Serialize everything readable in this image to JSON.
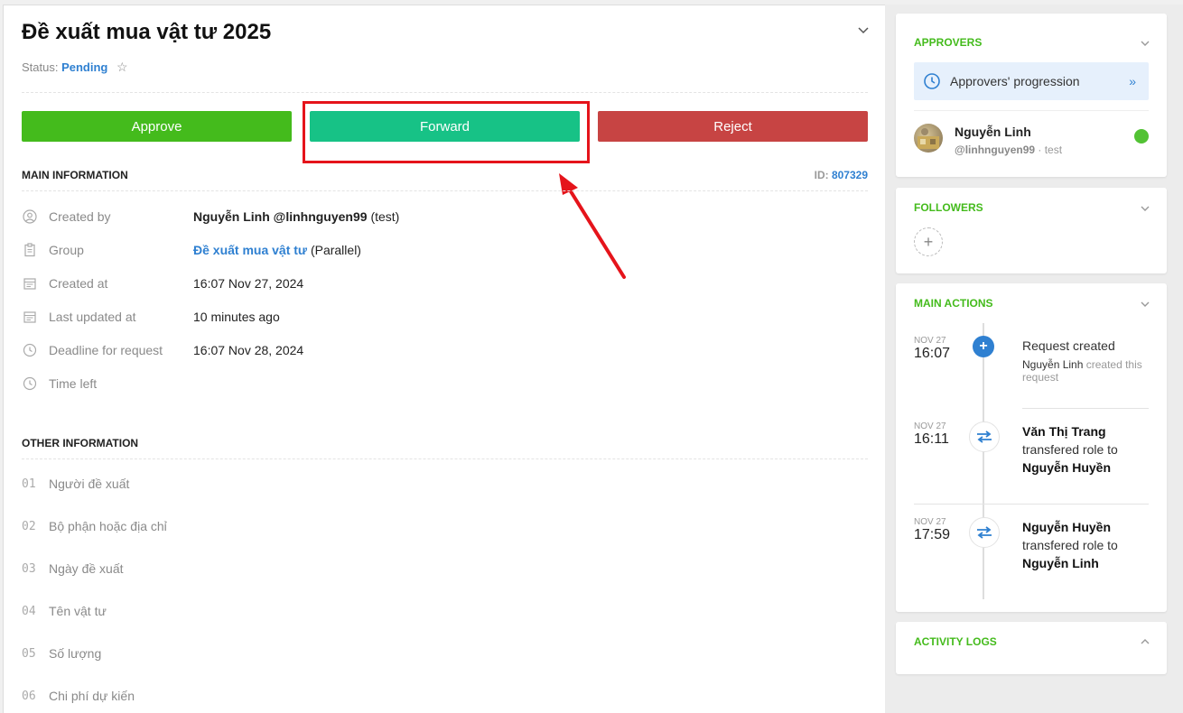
{
  "request": {
    "title": "Đề xuất mua vật tư 2025",
    "status_label": "Status:",
    "status_value": "Pending"
  },
  "actions": {
    "approve": "Approve",
    "forward": "Forward",
    "reject": "Reject"
  },
  "main_info": {
    "heading": "MAIN INFORMATION",
    "id_label": "ID:",
    "id_value": "807329",
    "rows": [
      {
        "label": "Created by",
        "value_bold": "Nguyễn Linh @linhnguyen99",
        "value_rest": " (test)"
      },
      {
        "label": "Group",
        "value_link": "Đề xuất mua vật tư",
        "value_rest": " (Parallel)"
      },
      {
        "label": "Created at",
        "value": "16:07 Nov 27, 2024"
      },
      {
        "label": "Last updated at",
        "value": "10 minutes ago"
      },
      {
        "label": "Deadline for request",
        "value": "16:07 Nov 28, 2024"
      },
      {
        "label": "Time left",
        "value": ""
      }
    ]
  },
  "other_info": {
    "heading": "OTHER INFORMATION",
    "rows": [
      {
        "num": "01",
        "label": "Người đề xuất"
      },
      {
        "num": "02",
        "label": "Bộ phận hoặc địa chỉ"
      },
      {
        "num": "03",
        "label": "Ngày đề xuất"
      },
      {
        "num": "04",
        "label": "Tên vật tư"
      },
      {
        "num": "05",
        "label": "Số lượng"
      },
      {
        "num": "06",
        "label": "Chi phí dự kiến"
      }
    ]
  },
  "approvers": {
    "heading": "APPROVERS",
    "progression_label": "Approvers' progression",
    "progression_chevron": "»",
    "user_name": "Nguyễn Linh",
    "user_handle": "@linhnguyen99",
    "user_sep": " · test"
  },
  "followers": {
    "heading": "FOLLOWERS",
    "add_symbol": "+"
  },
  "main_actions": {
    "heading": "MAIN ACTIONS",
    "items": [
      {
        "date": "NOV 27",
        "time": "16:07",
        "title": "Request created",
        "actor": "Nguyễn Linh",
        "desc": " created this request"
      },
      {
        "date": "NOV 27",
        "time": "16:11",
        "from": "Văn Thị Trang",
        "verb": "transfered role to",
        "to": "Nguyễn Huyền"
      },
      {
        "date": "NOV 27",
        "time": "17:59",
        "from": "Nguyễn Huyền",
        "verb": "transfered role to",
        "to": "Nguyễn Linh"
      }
    ]
  },
  "activity_logs": {
    "heading": "ACTIVITY LOGS"
  },
  "colors": {
    "approve": "#44bb1c",
    "forward": "#17c286",
    "reject": "#c74443",
    "accent": "#2f80d1",
    "section_green": "#44bb1c",
    "annotation_red": "#e5141b"
  }
}
